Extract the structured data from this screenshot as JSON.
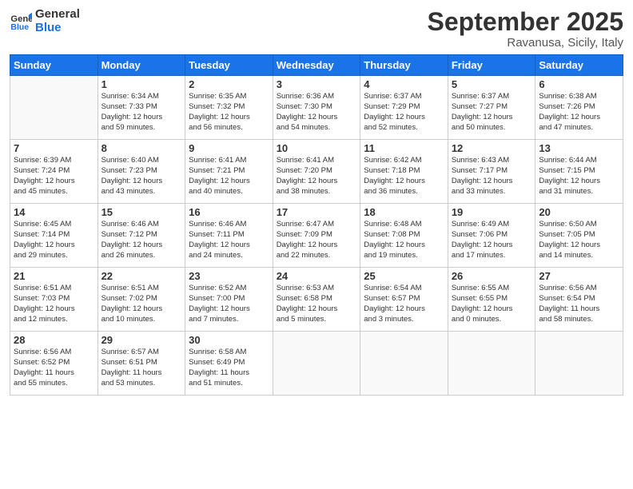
{
  "header": {
    "logo_line1": "General",
    "logo_line2": "Blue",
    "month_title": "September 2025",
    "location": "Ravanusa, Sicily, Italy"
  },
  "weekdays": [
    "Sunday",
    "Monday",
    "Tuesday",
    "Wednesday",
    "Thursday",
    "Friday",
    "Saturday"
  ],
  "weeks": [
    [
      {
        "day": "",
        "info": ""
      },
      {
        "day": "1",
        "info": "Sunrise: 6:34 AM\nSunset: 7:33 PM\nDaylight: 12 hours\nand 59 minutes."
      },
      {
        "day": "2",
        "info": "Sunrise: 6:35 AM\nSunset: 7:32 PM\nDaylight: 12 hours\nand 56 minutes."
      },
      {
        "day": "3",
        "info": "Sunrise: 6:36 AM\nSunset: 7:30 PM\nDaylight: 12 hours\nand 54 minutes."
      },
      {
        "day": "4",
        "info": "Sunrise: 6:37 AM\nSunset: 7:29 PM\nDaylight: 12 hours\nand 52 minutes."
      },
      {
        "day": "5",
        "info": "Sunrise: 6:37 AM\nSunset: 7:27 PM\nDaylight: 12 hours\nand 50 minutes."
      },
      {
        "day": "6",
        "info": "Sunrise: 6:38 AM\nSunset: 7:26 PM\nDaylight: 12 hours\nand 47 minutes."
      }
    ],
    [
      {
        "day": "7",
        "info": "Sunrise: 6:39 AM\nSunset: 7:24 PM\nDaylight: 12 hours\nand 45 minutes."
      },
      {
        "day": "8",
        "info": "Sunrise: 6:40 AM\nSunset: 7:23 PM\nDaylight: 12 hours\nand 43 minutes."
      },
      {
        "day": "9",
        "info": "Sunrise: 6:41 AM\nSunset: 7:21 PM\nDaylight: 12 hours\nand 40 minutes."
      },
      {
        "day": "10",
        "info": "Sunrise: 6:41 AM\nSunset: 7:20 PM\nDaylight: 12 hours\nand 38 minutes."
      },
      {
        "day": "11",
        "info": "Sunrise: 6:42 AM\nSunset: 7:18 PM\nDaylight: 12 hours\nand 36 minutes."
      },
      {
        "day": "12",
        "info": "Sunrise: 6:43 AM\nSunset: 7:17 PM\nDaylight: 12 hours\nand 33 minutes."
      },
      {
        "day": "13",
        "info": "Sunrise: 6:44 AM\nSunset: 7:15 PM\nDaylight: 12 hours\nand 31 minutes."
      }
    ],
    [
      {
        "day": "14",
        "info": "Sunrise: 6:45 AM\nSunset: 7:14 PM\nDaylight: 12 hours\nand 29 minutes."
      },
      {
        "day": "15",
        "info": "Sunrise: 6:46 AM\nSunset: 7:12 PM\nDaylight: 12 hours\nand 26 minutes."
      },
      {
        "day": "16",
        "info": "Sunrise: 6:46 AM\nSunset: 7:11 PM\nDaylight: 12 hours\nand 24 minutes."
      },
      {
        "day": "17",
        "info": "Sunrise: 6:47 AM\nSunset: 7:09 PM\nDaylight: 12 hours\nand 22 minutes."
      },
      {
        "day": "18",
        "info": "Sunrise: 6:48 AM\nSunset: 7:08 PM\nDaylight: 12 hours\nand 19 minutes."
      },
      {
        "day": "19",
        "info": "Sunrise: 6:49 AM\nSunset: 7:06 PM\nDaylight: 12 hours\nand 17 minutes."
      },
      {
        "day": "20",
        "info": "Sunrise: 6:50 AM\nSunset: 7:05 PM\nDaylight: 12 hours\nand 14 minutes."
      }
    ],
    [
      {
        "day": "21",
        "info": "Sunrise: 6:51 AM\nSunset: 7:03 PM\nDaylight: 12 hours\nand 12 minutes."
      },
      {
        "day": "22",
        "info": "Sunrise: 6:51 AM\nSunset: 7:02 PM\nDaylight: 12 hours\nand 10 minutes."
      },
      {
        "day": "23",
        "info": "Sunrise: 6:52 AM\nSunset: 7:00 PM\nDaylight: 12 hours\nand 7 minutes."
      },
      {
        "day": "24",
        "info": "Sunrise: 6:53 AM\nSunset: 6:58 PM\nDaylight: 12 hours\nand 5 minutes."
      },
      {
        "day": "25",
        "info": "Sunrise: 6:54 AM\nSunset: 6:57 PM\nDaylight: 12 hours\nand 3 minutes."
      },
      {
        "day": "26",
        "info": "Sunrise: 6:55 AM\nSunset: 6:55 PM\nDaylight: 12 hours\nand 0 minutes."
      },
      {
        "day": "27",
        "info": "Sunrise: 6:56 AM\nSunset: 6:54 PM\nDaylight: 11 hours\nand 58 minutes."
      }
    ],
    [
      {
        "day": "28",
        "info": "Sunrise: 6:56 AM\nSunset: 6:52 PM\nDaylight: 11 hours\nand 55 minutes."
      },
      {
        "day": "29",
        "info": "Sunrise: 6:57 AM\nSunset: 6:51 PM\nDaylight: 11 hours\nand 53 minutes."
      },
      {
        "day": "30",
        "info": "Sunrise: 6:58 AM\nSunset: 6:49 PM\nDaylight: 11 hours\nand 51 minutes."
      },
      {
        "day": "",
        "info": ""
      },
      {
        "day": "",
        "info": ""
      },
      {
        "day": "",
        "info": ""
      },
      {
        "day": "",
        "info": ""
      }
    ]
  ]
}
